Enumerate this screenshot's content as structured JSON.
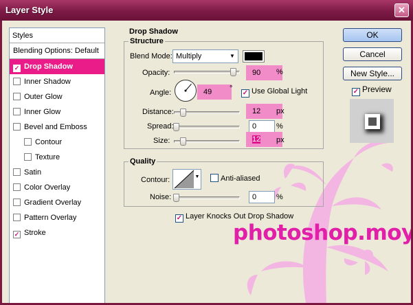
{
  "window": {
    "title": "Layer Style",
    "close_glyph": "✕"
  },
  "styles_panel": {
    "header": "Styles",
    "blending_options": "Blending Options: Default",
    "items": [
      {
        "label": "Drop Shadow",
        "checked": true,
        "selected": true
      },
      {
        "label": "Inner Shadow",
        "checked": false
      },
      {
        "label": "Outer Glow",
        "checked": false
      },
      {
        "label": "Inner Glow",
        "checked": false
      },
      {
        "label": "Bevel and Emboss",
        "checked": false
      },
      {
        "label": "Contour",
        "checked": false,
        "indent": true
      },
      {
        "label": "Texture",
        "checked": false,
        "indent": true
      },
      {
        "label": "Satin",
        "checked": false
      },
      {
        "label": "Color Overlay",
        "checked": false
      },
      {
        "label": "Gradient Overlay",
        "checked": false
      },
      {
        "label": "Pattern Overlay",
        "checked": false
      },
      {
        "label": "Stroke",
        "checked": true
      }
    ]
  },
  "drop_shadow": {
    "title": "Drop Shadow",
    "structure": {
      "title": "Structure",
      "blend_mode_label": "Blend Mode:",
      "blend_mode_value": "Multiply",
      "shadow_color": "#000000",
      "opacity_label": "Opacity:",
      "opacity_value": "90",
      "opacity_unit": "%",
      "opacity_level": 0.9,
      "angle_label": "Angle:",
      "angle_value": "49",
      "angle_unit": "°",
      "use_global_light_label": "Use Global Light",
      "use_global_light": true,
      "distance_label": "Distance:",
      "distance_value": "12",
      "distance_unit": "px",
      "spread_label": "Spread:",
      "spread_value": "0",
      "spread_unit": "%",
      "size_label": "Size:",
      "size_value": "12",
      "size_unit": "px"
    },
    "quality": {
      "title": "Quality",
      "contour_label": "Contour:",
      "anti_aliased_label": "Anti-aliased",
      "anti_aliased": false,
      "noise_label": "Noise:",
      "noise_value": "0",
      "noise_unit": "%"
    },
    "knockout_label": "Layer Knocks Out Drop Shadow",
    "knockout": true
  },
  "buttons": {
    "ok": "OK",
    "cancel": "Cancel",
    "new_style": "New Style...",
    "preview_label": "Preview",
    "preview": true
  },
  "watermark": "photoshop.moy.su",
  "colors": {
    "title_bar": "#7c1a46",
    "selection": "#ea1c8a",
    "highlight": "#f28cc8",
    "watermark": "#e11fa8",
    "dialog_bg": "#ece9d8"
  },
  "icons": {
    "check": "✓",
    "dropdown": "▼"
  }
}
